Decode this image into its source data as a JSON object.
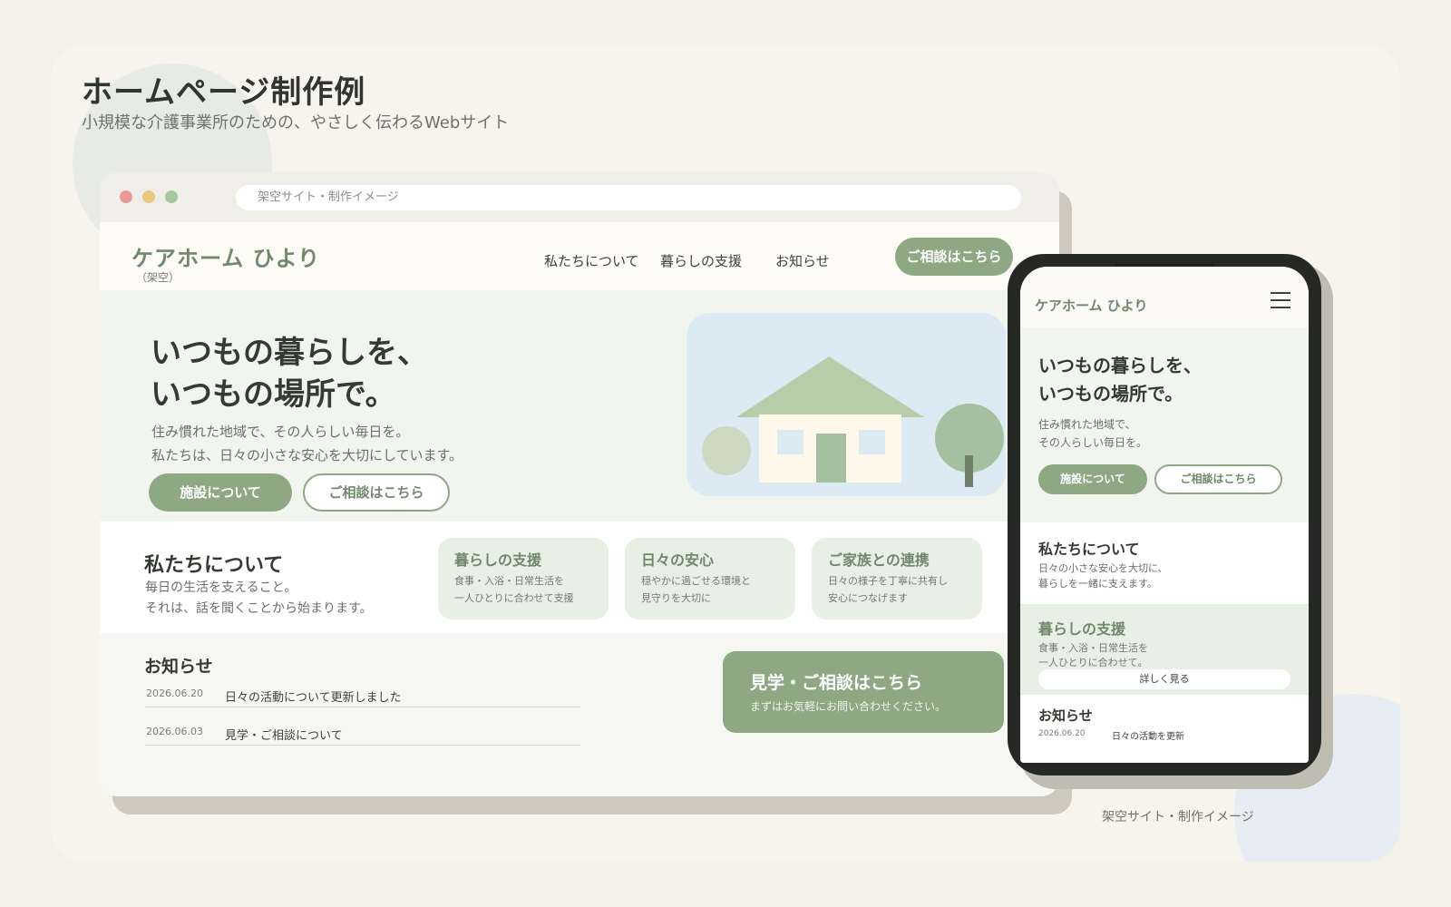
{
  "page": {
    "title": "ホームページ制作例",
    "subtitle": "小規模な介護事業所のための、やさしく伝わるWebサイト",
    "caption": "架空サイト・制作イメージ"
  },
  "browser": {
    "url": "架空サイト・制作イメージ"
  },
  "site": {
    "logo": "ケアホーム ひより",
    "logo_note": "（架空）",
    "nav": [
      "私たちについて",
      "暮らしの支援",
      "お知らせ"
    ],
    "header_cta": "ご相談はこちら",
    "hero": {
      "title_line1": "いつもの暮らしを、",
      "title_line2": "いつもの場所で。",
      "text_line1": "住み慣れた地域で、その人らしい毎日を。",
      "text_line2": "私たちは、日々の小さな安心を大切にしています。",
      "button_primary": "施設について",
      "button_secondary": "ご相談はこちら"
    },
    "about": {
      "title": "私たちについて",
      "text_line1": "毎日の生活を支えること。",
      "text_line2": "それは、話を聞くことから始まります。",
      "cards": [
        {
          "title": "暮らしの支援",
          "line1": "食事・入浴・日常生活を",
          "line2": "一人ひとりに合わせて支援"
        },
        {
          "title": "日々の安心",
          "line1": "穏やかに過ごせる環境と",
          "line2": "見守りを大切に"
        },
        {
          "title": "ご家族との連携",
          "line1": "日々の様子を丁寧に共有し",
          "line2": "安心につなげます"
        }
      ]
    },
    "news": {
      "title": "お知らせ",
      "items": [
        {
          "date": "2026.06.20",
          "text": "日々の活動について更新しました"
        },
        {
          "date": "2026.06.03",
          "text": "見学・ご相談について"
        }
      ]
    },
    "contact": {
      "title": "見学・ご相談はこちら",
      "text": "まずはお気軽にお問い合わせください。"
    }
  },
  "mobile": {
    "logo": "ケアホーム ひより",
    "hero": {
      "title_line1": "いつもの暮らしを、",
      "title_line2": "いつもの場所で。",
      "text_line1": "住み慣れた地域で、",
      "text_line2": "その人らしい毎日を。",
      "button_primary": "施設について",
      "button_secondary": "ご相談はこちら"
    },
    "about": {
      "title": "私たちについて",
      "text_line1": "日々の小さな安心を大切に、",
      "text_line2": "暮らしを一緒に支えます。"
    },
    "support": {
      "title": "暮らしの支援",
      "text_line1": "食事・入浴・日常生活を",
      "text_line2": "一人ひとりに合わせて。",
      "button": "詳しく見る"
    },
    "news": {
      "title": "お知らせ",
      "date": "2026.06.20",
      "text": "日々の活動を更新"
    }
  },
  "colors": {
    "accent": "#8ea884",
    "accent_text": "#6f8a6b",
    "background": "#f4f1e9",
    "card": "#e8efe5"
  }
}
